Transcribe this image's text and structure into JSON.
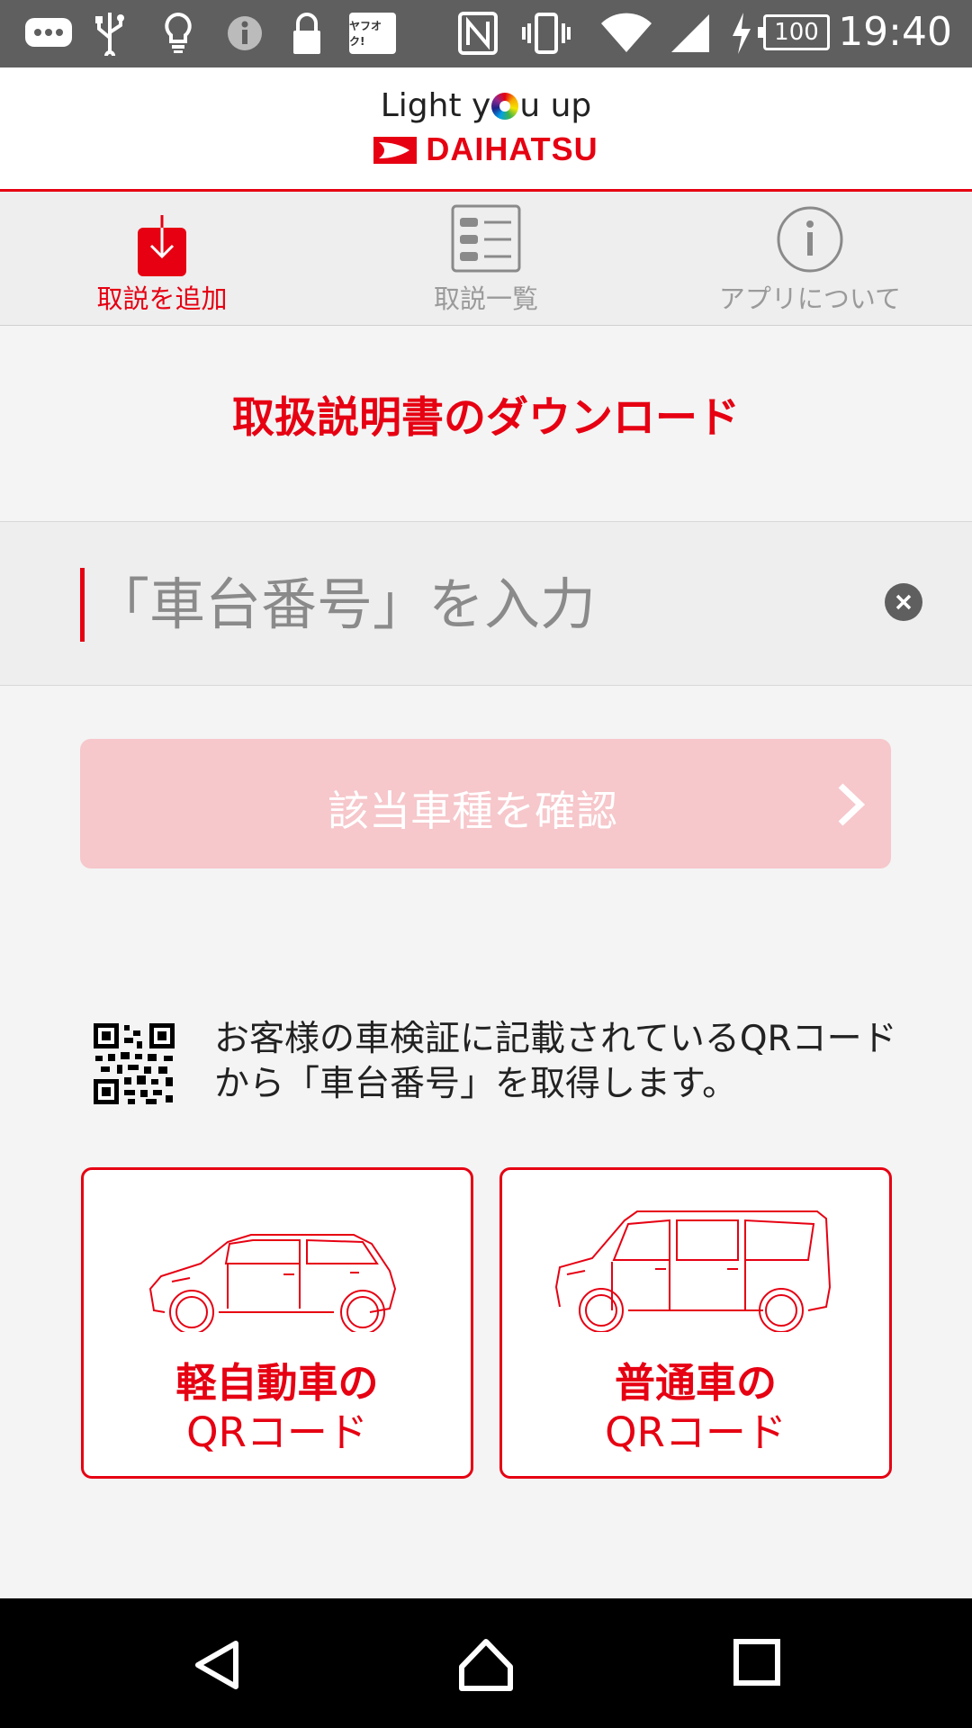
{
  "status_bar": {
    "time": "19:40",
    "battery": "100",
    "yahoo_badge": "ヤフオク!",
    "icons": [
      "more-icon",
      "usb-icon",
      "bulb-icon",
      "info-icon",
      "lock-icon",
      "yahoo-auction-icon",
      "nfc-icon",
      "vibrate-icon",
      "wifi-icon",
      "signal-icon",
      "charging-icon",
      "battery-icon"
    ]
  },
  "header": {
    "tagline_pre": "Light y",
    "tagline_post": "u up",
    "brand": "DAIHATSU"
  },
  "tabs": [
    {
      "label": "取説を追加",
      "icon": "download-icon",
      "active": true
    },
    {
      "label": "取説一覧",
      "icon": "list-icon",
      "active": false
    },
    {
      "label": "アプリについて",
      "icon": "info-circle-icon",
      "active": false
    }
  ],
  "section_title": "取扱説明書のダウンロード",
  "search": {
    "placeholder": "「車台番号」を入力",
    "value": ""
  },
  "confirm_button": {
    "label": "該当車種を確認"
  },
  "qr_note": "お客様の車検証に記載されているQRコードから「車台番号」を取得します。",
  "cards": [
    {
      "title": "軽自動車の",
      "subtitle": "QRコード"
    },
    {
      "title": "普通車の",
      "subtitle": "QRコード"
    }
  ],
  "colors": {
    "accent": "#e60012",
    "button_disabled": "#f6c7cb",
    "statusbar": "#5f5f5f"
  }
}
